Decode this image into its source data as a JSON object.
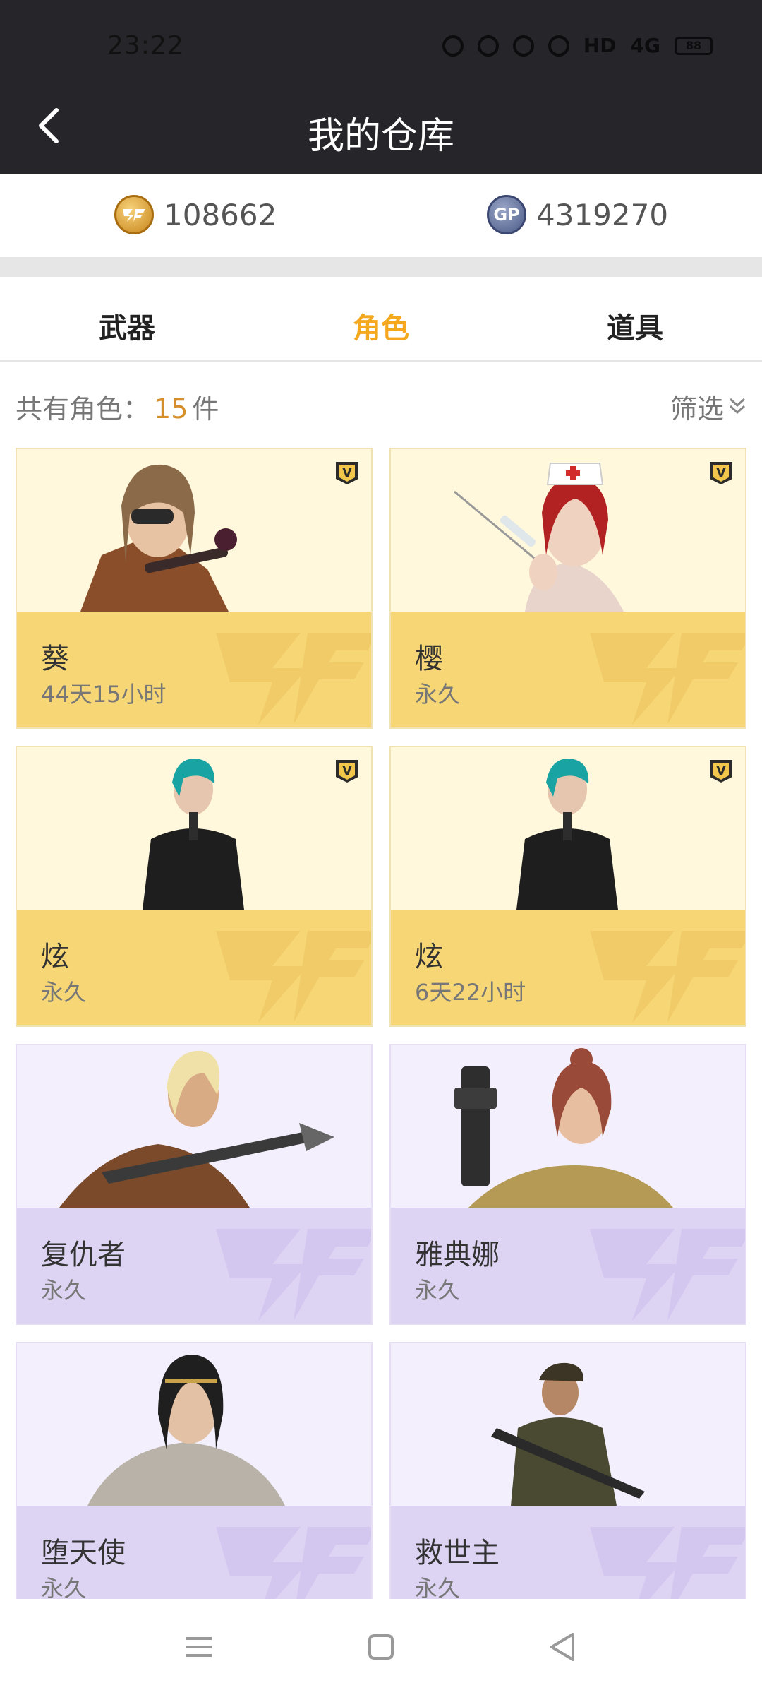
{
  "status": {
    "time": "23:22",
    "hd": "HD",
    "net": "4G",
    "battery": "88"
  },
  "header": {
    "title": "我的仓库"
  },
  "currency": {
    "cf_points": "108662",
    "gp": "4319270",
    "gp_label": "GP"
  },
  "tabs": [
    {
      "label": "武器",
      "active": false
    },
    {
      "label": "角色",
      "active": true
    },
    {
      "label": "道具",
      "active": false
    }
  ],
  "summary": {
    "prefix": "共有角色：",
    "count": "15",
    "unit": "件",
    "filter": "筛选"
  },
  "characters": [
    {
      "name": "葵",
      "duration": "44天15小时",
      "tier": "gold",
      "vip": true
    },
    {
      "name": "樱",
      "duration": "永久",
      "tier": "gold",
      "vip": true
    },
    {
      "name": "炫",
      "duration": "永久",
      "tier": "gold",
      "vip": true
    },
    {
      "name": "炫",
      "duration": "6天22小时",
      "tier": "gold",
      "vip": true
    },
    {
      "name": "复仇者",
      "duration": "永久",
      "tier": "purple",
      "vip": false
    },
    {
      "name": "雅典娜",
      "duration": "永久",
      "tier": "purple",
      "vip": false
    },
    {
      "name": "堕天使",
      "duration": "永久",
      "tier": "purple",
      "vip": false
    },
    {
      "name": "救世主",
      "duration": "永久",
      "tier": "purple",
      "vip": false
    }
  ],
  "icons": {
    "back": "back-arrow-icon",
    "vip": "vip-badge-icon",
    "filter": "chevron-double-down-icon",
    "nav": [
      "menu-icon",
      "home-square-icon",
      "back-triangle-icon"
    ]
  },
  "colors": {
    "accent": "#f4a81d",
    "count": "#d48f2a",
    "gold_card": "#f6d675",
    "purple_card": "#ddd3f3",
    "header_bg": "#26262a"
  }
}
